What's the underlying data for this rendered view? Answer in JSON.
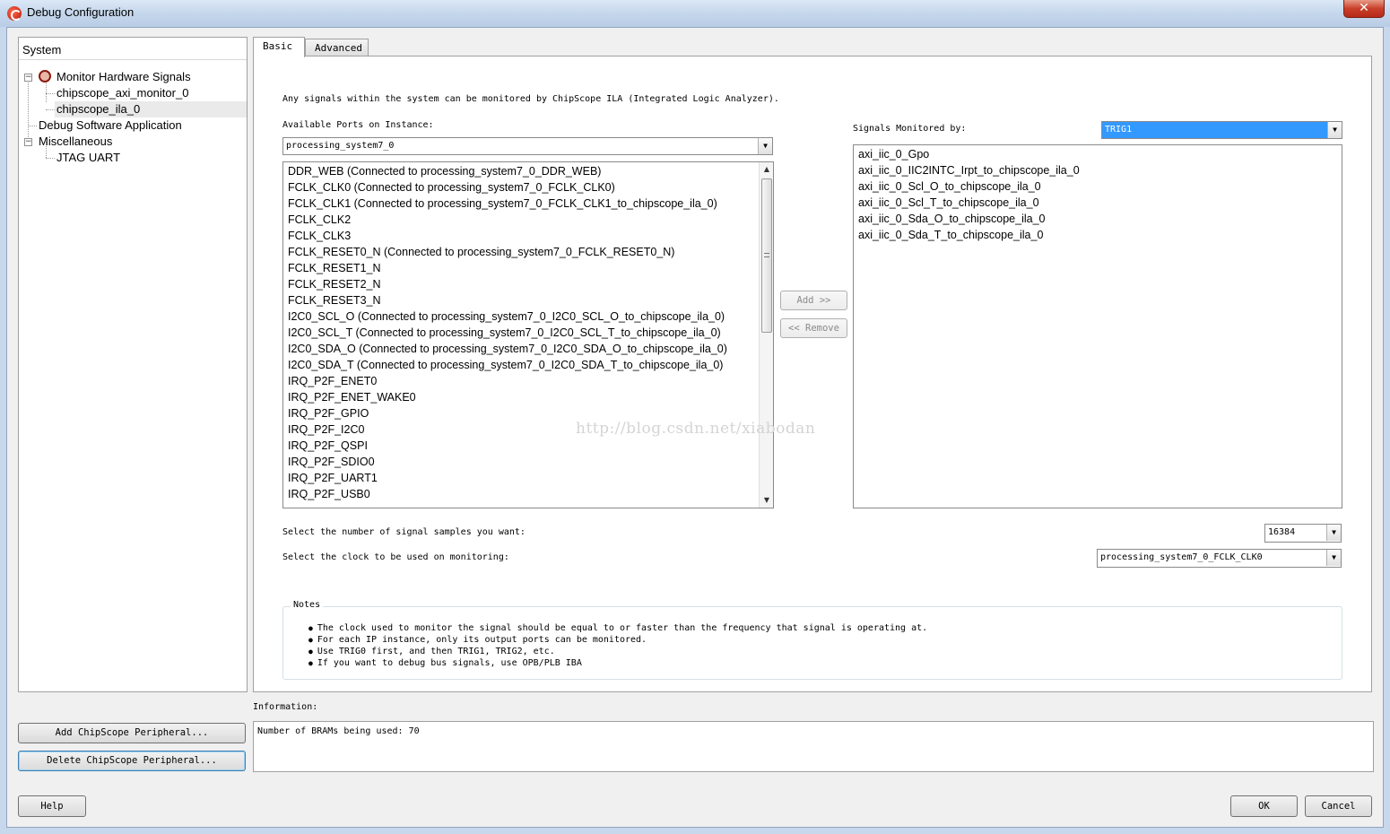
{
  "window": {
    "title": "Debug Configuration",
    "close_glyph": "✕"
  },
  "system_panel": {
    "header": "System",
    "tree": {
      "monitor_hw": "Monitor Hardware Signals",
      "axi_monitor": "chipscope_axi_monitor_0",
      "ila": "chipscope_ila_0",
      "debug_sw": "Debug Software Application",
      "misc": "Miscellaneous",
      "jtag_uart": "JTAG UART"
    },
    "expand_glyph": "−"
  },
  "tabs": {
    "basic": "Basic",
    "advanced": "Advanced"
  },
  "basic": {
    "description": "Any signals within the system can be monitored by ChipScope ILA (Integrated Logic Analyzer).",
    "available_ports_label": "Available Ports on Instance:",
    "instance_value": "processing_system7_0",
    "ports": [
      "DDR_WEB (Connected to processing_system7_0_DDR_WEB)",
      "FCLK_CLK0 (Connected to processing_system7_0_FCLK_CLK0)",
      "FCLK_CLK1 (Connected to processing_system7_0_FCLK_CLK1_to_chipscope_ila_0)",
      "FCLK_CLK2",
      "FCLK_CLK3",
      "FCLK_RESET0_N (Connected to processing_system7_0_FCLK_RESET0_N)",
      "FCLK_RESET1_N",
      "FCLK_RESET2_N",
      "FCLK_RESET3_N",
      "I2C0_SCL_O (Connected to processing_system7_0_I2C0_SCL_O_to_chipscope_ila_0)",
      "I2C0_SCL_T (Connected to processing_system7_0_I2C0_SCL_T_to_chipscope_ila_0)",
      "I2C0_SDA_O (Connected to processing_system7_0_I2C0_SDA_O_to_chipscope_ila_0)",
      "I2C0_SDA_T (Connected to processing_system7_0_I2C0_SDA_T_to_chipscope_ila_0)",
      "IRQ_P2F_ENET0",
      "IRQ_P2F_ENET_WAKE0",
      "IRQ_P2F_GPIO",
      "IRQ_P2F_I2C0",
      "IRQ_P2F_QSPI",
      "IRQ_P2F_SDIO0",
      "IRQ_P2F_UART1",
      "IRQ_P2F_USB0"
    ],
    "add_button": "Add >>",
    "remove_button": "<< Remove",
    "signals_monitored_label": "Signals Monitored by:",
    "trigger_value": "TRIG1",
    "monitored_signals": [
      "axi_iic_0_Gpo",
      "axi_iic_0_IIC2INTC_Irpt_to_chipscope_ila_0",
      "axi_iic_0_Scl_O_to_chipscope_ila_0",
      "axi_iic_0_Scl_T_to_chipscope_ila_0",
      "axi_iic_0_Sda_O_to_chipscope_ila_0",
      "axi_iic_0_Sda_T_to_chipscope_ila_0"
    ],
    "samples_label": "Select the number of signal samples you want:",
    "samples_value": "16384",
    "clock_label": "Select the clock to be used on monitoring:",
    "clock_value": "processing_system7_0_FCLK_CLK0",
    "notes_title": "Notes",
    "notes": [
      "The clock used to monitor the signal should be equal to or faster than the frequency that signal is operating at.",
      "For each IP instance, only its output ports can be monitored.",
      "Use TRIG0 first, and then TRIG1, TRIG2, etc.",
      "If you want to debug bus signals, use OPB/PLB IBA"
    ],
    "watermark": "http://blog.csdn.net/xiabodan"
  },
  "information": {
    "label": "Information:",
    "text": "Number of BRAMs being used: 70"
  },
  "buttons": {
    "add_peripheral": "Add ChipScope Peripheral...",
    "delete_peripheral": "Delete ChipScope Peripheral...",
    "help": "Help",
    "ok": "OK",
    "cancel": "Cancel"
  },
  "icons": {
    "dropdown_arrow": "▼",
    "scroll_up": "▲",
    "scroll_down": "▼"
  },
  "colors": {
    "title_bar": "#c5d7ec",
    "selection": "#3399ff",
    "close_button": "#c9402b"
  }
}
